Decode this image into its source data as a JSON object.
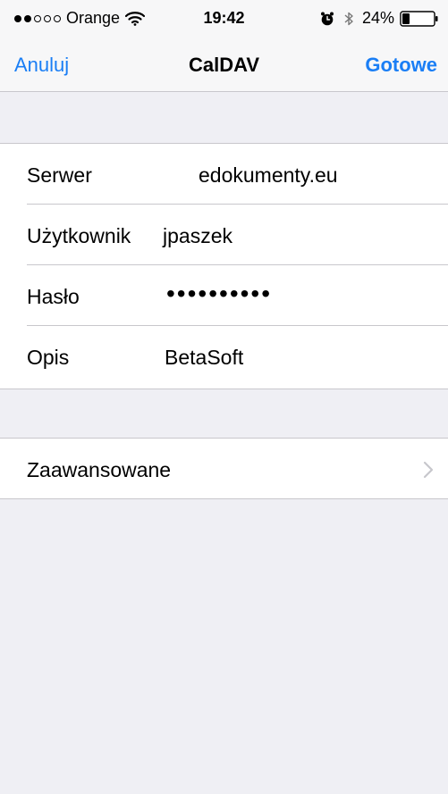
{
  "status": {
    "carrier": "Orange",
    "time": "19:42",
    "battery_percent": "24%",
    "battery_level": 0.24,
    "signal_bars_filled": 2,
    "signal_bars_total": 5,
    "icons": [
      "wifi-icon",
      "alarm-icon",
      "bluetooth-icon",
      "battery-icon"
    ]
  },
  "nav": {
    "cancel_label": "Anuluj",
    "title": "CalDAV",
    "done_label": "Gotowe"
  },
  "form": {
    "server_label": "Serwer",
    "server_value": "edokumenty.eu",
    "user_label": "Użytkownik",
    "user_value": "jpaszek",
    "password_label": "Hasło",
    "password_value": "••••••••••",
    "description_label": "Opis",
    "description_value": "BetaSoft"
  },
  "advanced": {
    "label": "Zaawansowane",
    "icon": "chevron-right-icon"
  },
  "colors": {
    "accent": "#1a7ef5",
    "background": "#efeff4",
    "separator": "#c8c7cc"
  }
}
